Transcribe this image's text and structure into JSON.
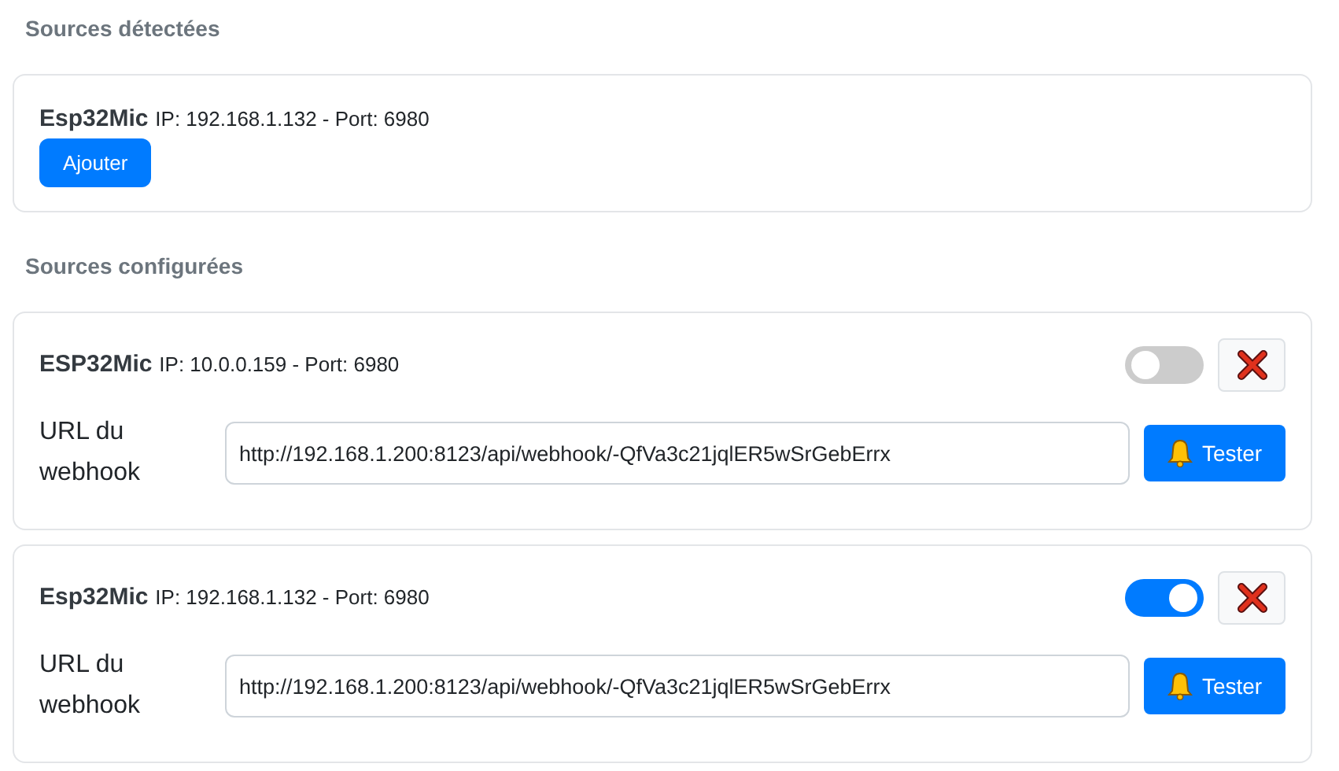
{
  "detected": {
    "heading": "Sources détectées",
    "sources": [
      {
        "name": "Esp32Mic",
        "details": "IP: 192.168.1.132 - Port: 6980",
        "button": "Ajouter"
      }
    ]
  },
  "configured": {
    "heading": "Sources configurées",
    "sources": [
      {
        "name": "ESP32Mic",
        "details": "IP: 10.0.0.159 - Port: 6980",
        "on": false,
        "url_label": "URL du webhook",
        "url": "http://192.168.1.200:8123/api/webhook/-QfVa3c21jqlER5wSrGebErrx",
        "test_button": "Tester"
      },
      {
        "name": "Esp32Mic",
        "details": "IP: 192.168.1.132 - Port: 6980",
        "on": true,
        "url_label": "URL du webhook",
        "url": "http://192.168.1.200:8123/api/webhook/-QfVa3c21jqlER5wSrGebErrx",
        "test_button": "Tester"
      }
    ]
  }
}
